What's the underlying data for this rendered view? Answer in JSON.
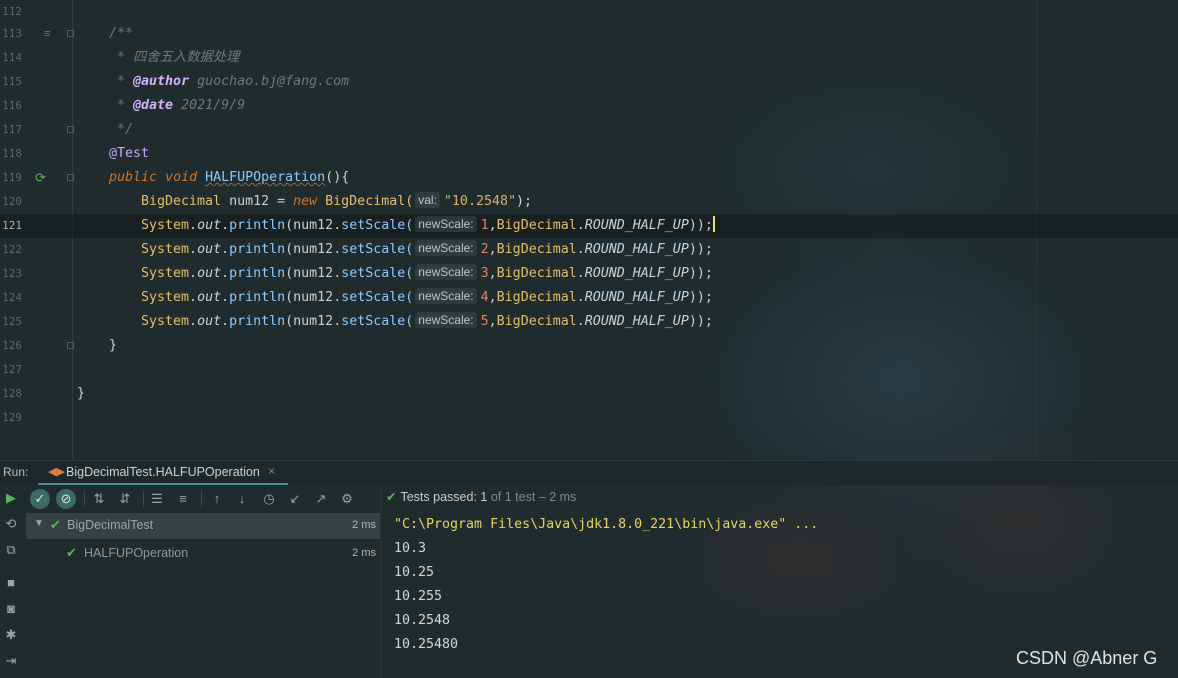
{
  "editor": {
    "lines": [
      {
        "no": "112"
      },
      {
        "no": "113"
      },
      {
        "no": "114"
      },
      {
        "no": "115"
      },
      {
        "no": "116"
      },
      {
        "no": "117"
      },
      {
        "no": "118"
      },
      {
        "no": "119"
      },
      {
        "no": "120"
      },
      {
        "no": "121"
      },
      {
        "no": "122"
      },
      {
        "no": "123"
      },
      {
        "no": "124"
      },
      {
        "no": "125"
      },
      {
        "no": "126"
      },
      {
        "no": "127"
      },
      {
        "no": "128"
      },
      {
        "no": "129"
      }
    ],
    "javadoc_open": "/**",
    "javadoc_desc": " * 四舍五入数据处理",
    "author_tag": "@author",
    "author_value": " guochao.bj@fang.com",
    "date_tag": "@date",
    "date_value": " 2021/9/9",
    "javadoc_close": " */",
    "annotation": "@Test",
    "kw_public": "public",
    "kw_void": "void",
    "method_name": "HALFUPOperation",
    "method_tail": "(){",
    "decl_type": "BigDecimal",
    "decl_var": " num12 = ",
    "kw_new": "new",
    "decl_ctor": " BigDecimal(",
    "hint_val": "val:",
    "decl_arg": "\"10.2548\"",
    "decl_end": ");",
    "print_system": "System",
    "print_out": "out",
    "print_println": "println",
    "print_var": "(num12.",
    "print_setscale": "setScale(",
    "hint_newscale": "newScale:",
    "print_class": "BigDecimal",
    "print_const": "ROUND_HALF_UP",
    "print_end": "));",
    "scales": [
      "1",
      "2",
      "3",
      "4",
      "5"
    ],
    "close_method": "}",
    "close_class": "}"
  },
  "run_panel": {
    "label": "Run:",
    "tab_title": "BigDecimalTest.HALFUPOperation",
    "tab_close": "×",
    "status_prefix": "Tests passed:",
    "status_count": "1",
    "status_meta": "of 1 test – 2 ms",
    "tree": [
      {
        "label": "BigDecimalTest",
        "time": "2 ms"
      },
      {
        "label": "HALFUPOperation",
        "time": "2 ms"
      }
    ],
    "console": [
      "\"C:\\Program Files\\Java\\jdk1.8.0_221\\bin\\java.exe\" ...",
      "10.3",
      "10.25",
      "10.255",
      "10.2548",
      "10.25480"
    ]
  },
  "icons": {
    "run": "play-icon",
    "rerun": "rerun-icon",
    "passed_filter": "check-icon",
    "ignored_filter": "ban-icon",
    "sort_alpha": "sort-alpha-icon",
    "sort_duration": "sort-duration-icon",
    "expand_all": "expand-all-icon",
    "collapse_all": "collapse-all-icon",
    "prev": "arrow-up-icon",
    "next": "arrow-down-icon",
    "history": "history-icon",
    "import": "import-icon",
    "export": "export-icon",
    "settings": "gear-icon"
  },
  "watermark": "CSDN @Abner G",
  "colors": {
    "background": "#1f2b2d",
    "keyword": "#cc7832",
    "string": "#d6b46b",
    "number": "#e5845f",
    "method": "#8ec9ff",
    "success": "#5fb35f",
    "console_cmd": "#e6d85c"
  }
}
